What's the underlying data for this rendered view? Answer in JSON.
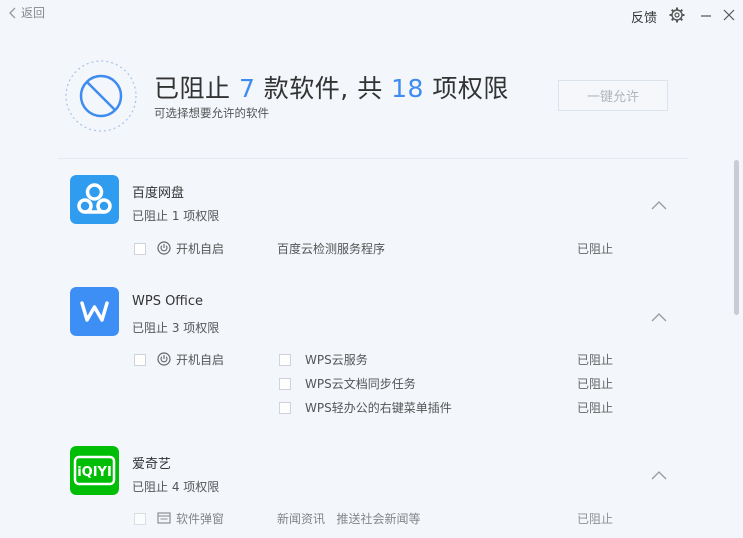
{
  "topbar": {
    "back_label": "返回",
    "feedback_label": "反馈"
  },
  "header": {
    "prefix": "已阻止 ",
    "blocked_apps": "7",
    "mid": " 款软件, 共 ",
    "permissions": "18",
    "suffix": " 项权限",
    "subtitle": "可选择想要允许的软件",
    "allow_all_label": "一键允许"
  },
  "colors": {
    "accent": "#3e8cf0",
    "baidu": "#2f9cf0",
    "wps": "#3d8ef5",
    "iqiyi": "#00be06"
  },
  "apps": [
    {
      "name": "百度网盘",
      "count_label": "已阻止 1 项权限",
      "icon": "baidu-netdisk-icon",
      "category": "开机自启",
      "items": [
        {
          "desc": "百度云检测服务程序",
          "status": "已阻止"
        }
      ]
    },
    {
      "name": "WPS Office",
      "count_label": "已阻止 3 项权限",
      "icon": "wps-office-icon",
      "category": "开机自启",
      "items": [
        {
          "desc": "WPS云服务",
          "status": "已阻止"
        },
        {
          "desc": "WPS云文档同步任务",
          "status": "已阻止"
        },
        {
          "desc": "WPS轻办公的右键菜单插件",
          "status": "已阻止"
        }
      ]
    },
    {
      "name": "爱奇艺",
      "count_label": "已阻止 4 项权限",
      "icon": "iqiyi-icon",
      "category": "软件弹窗",
      "items": [
        {
          "desc": "新闻资讯   推送社会新闻等",
          "status": "已阻止"
        }
      ]
    }
  ]
}
